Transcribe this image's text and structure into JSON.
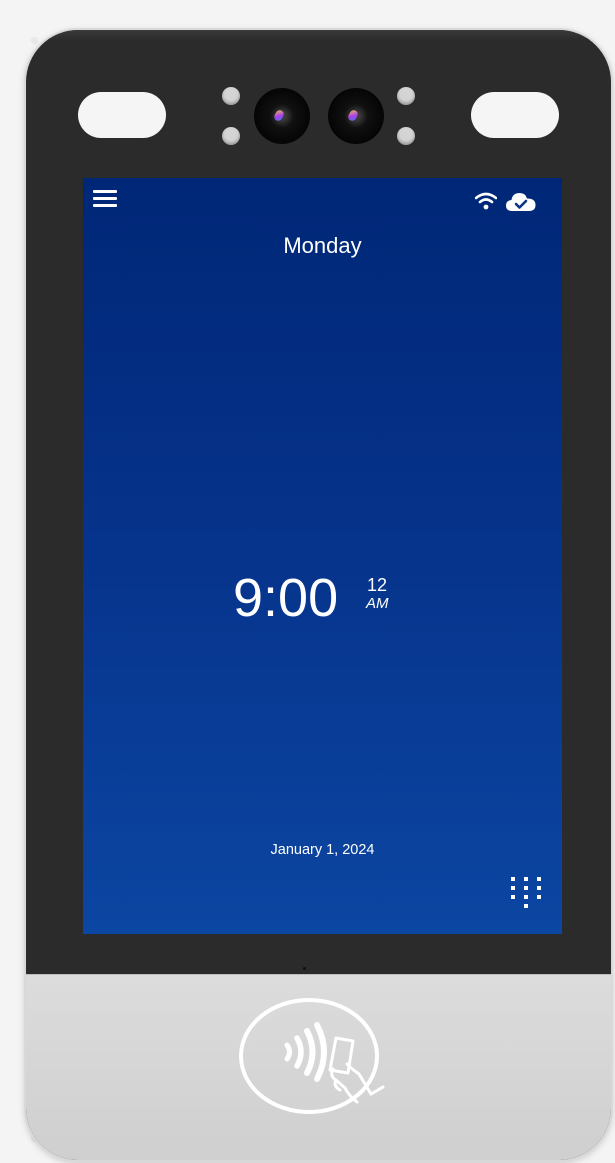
{
  "screen": {
    "day": "Monday",
    "time": {
      "hours_minutes": "9:00",
      "seconds": "12",
      "period": "AM"
    },
    "date": "January 1, 2024"
  },
  "icons": {
    "menu": "menu-icon",
    "wifi": "wifi-icon",
    "cloud_sync": "cloud-check-icon",
    "keypad": "keypad-icon",
    "contactless": "contactless-card-icon"
  },
  "colors": {
    "screen_top": "#002777",
    "screen_bottom": "#0b46a2",
    "bezel": "#2b2b2b",
    "panel": "#d6d6d6"
  }
}
